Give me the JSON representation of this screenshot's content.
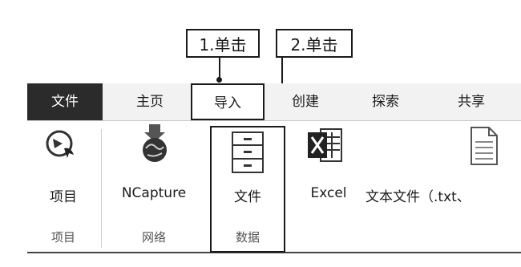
{
  "callouts": {
    "step1": "1.单击",
    "step2": "2.单击"
  },
  "tabs": {
    "file": "文件",
    "home": "主页",
    "import": "导入",
    "create": "创建",
    "explore": "探索",
    "share": "共享"
  },
  "ribbon": {
    "project_button": "项目",
    "ncapture_button": "NCapture",
    "file_button": "文件",
    "excel_button": "Excel",
    "text_file_button": "文本文件（.txt、",
    "group_project": "项目",
    "group_network": "网络",
    "group_data": "数据"
  },
  "icons": {
    "project": "project-icon",
    "ncapture": "ncapture-icon",
    "file": "file-cabinet-icon",
    "excel": "excel-icon",
    "text_file": "text-document-icon"
  }
}
